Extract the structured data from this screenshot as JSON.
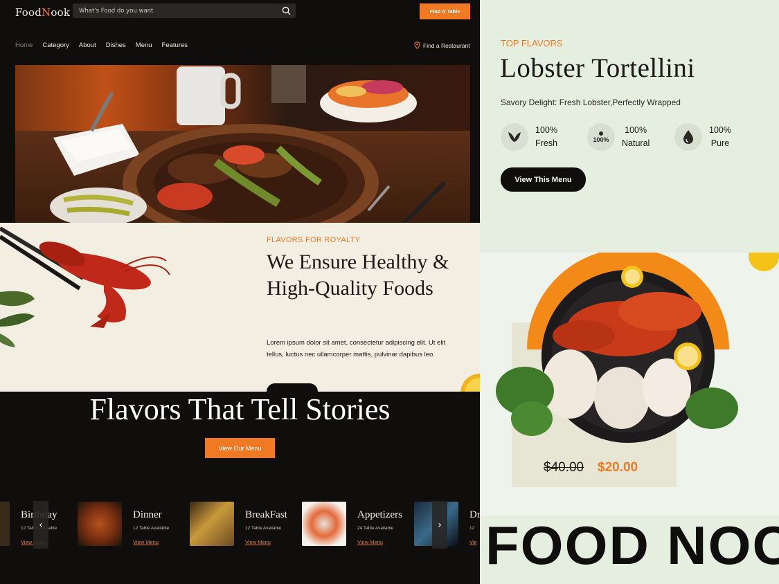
{
  "header": {
    "logo_prefix": "Food",
    "logo_n": "N",
    "logo_suffix": "ook",
    "search_placeholder": "What's Food do you want",
    "find_table_label": "Find A Table"
  },
  "nav": {
    "items": [
      "Home",
      "Category",
      "About",
      "Dishes",
      "Menu",
      "Features"
    ],
    "find_restaurant": "Find a Restaurant"
  },
  "royalty": {
    "eyebrow": "FLAVORS FOR ROYALTY",
    "headline": "We Ensure Healthy & High-Quality Foods",
    "body": "Lorem ipsum dolor sit amet, consectetur adipiscing elit. Ut elit tellus, luctus nec ullamcorper mattis, pulvinar dapibus leo."
  },
  "stories": {
    "headline": "Flavors That Tell Stories",
    "cta": "View Our Menu"
  },
  "categories": [
    {
      "title": "Birthday",
      "sub": "12 Table Available",
      "link": "View Menu"
    },
    {
      "title": "Dinner",
      "sub": "12 Table Available",
      "link": "View Menu"
    },
    {
      "title": "BreakFast",
      "sub": "12 Table Available",
      "link": "View Menu"
    },
    {
      "title": "Appetizers",
      "sub": "24 Table Available",
      "link": "View Menu"
    },
    {
      "title": "Dr",
      "sub": "12",
      "link": "Vie"
    }
  ],
  "feature": {
    "eyebrow": "TOP FLAVORS",
    "title": "Lobster Tortellini",
    "subtitle": "Savory Delight: Fresh Lobster,Perfectly Wrapped",
    "badges": [
      {
        "pct": "100%",
        "label": "Fresh",
        "icon": "leaf-icon"
      },
      {
        "pct": "100%",
        "label": "Natural",
        "icon": "natural-100-icon"
      },
      {
        "pct": "100%",
        "label": "Pure",
        "icon": "drop-icon"
      }
    ],
    "button": "View This Menu"
  },
  "product": {
    "old_price": "$40.00",
    "new_price": "$20.00"
  },
  "brand_banner": "FOOD NOOK",
  "colors": {
    "accent": "#f07a24",
    "dark": "#0f0e0c",
    "cream": "#f2efe2",
    "mint": "#e5efe0"
  }
}
